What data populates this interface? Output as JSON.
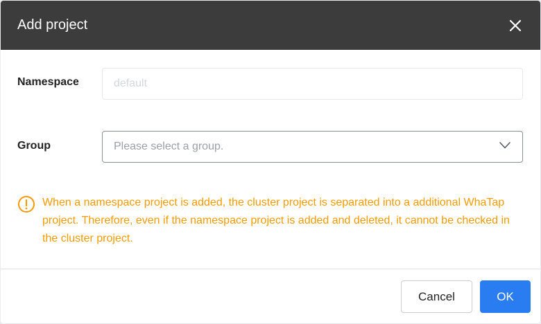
{
  "dialog": {
    "title": "Add project",
    "close_icon": "close-icon"
  },
  "form": {
    "namespace": {
      "label": "Namespace",
      "placeholder": "default"
    },
    "group": {
      "label": "Group",
      "placeholder": "Please select a group.",
      "dropdown_icon": "chevron-down-icon"
    }
  },
  "notice": {
    "icon": "warning-circle-icon",
    "text": "When a namespace project is added, the cluster project is separated into a additional WhaTap project. Therefore, even if the namespace project is added and deleted, it cannot be checked in the cluster project.",
    "color": "#f59a00"
  },
  "footer": {
    "cancel_label": "Cancel",
    "ok_label": "OK"
  },
  "colors": {
    "header_bg": "#3c3c3c",
    "primary": "#2a7df0",
    "warning": "#f59a00"
  }
}
